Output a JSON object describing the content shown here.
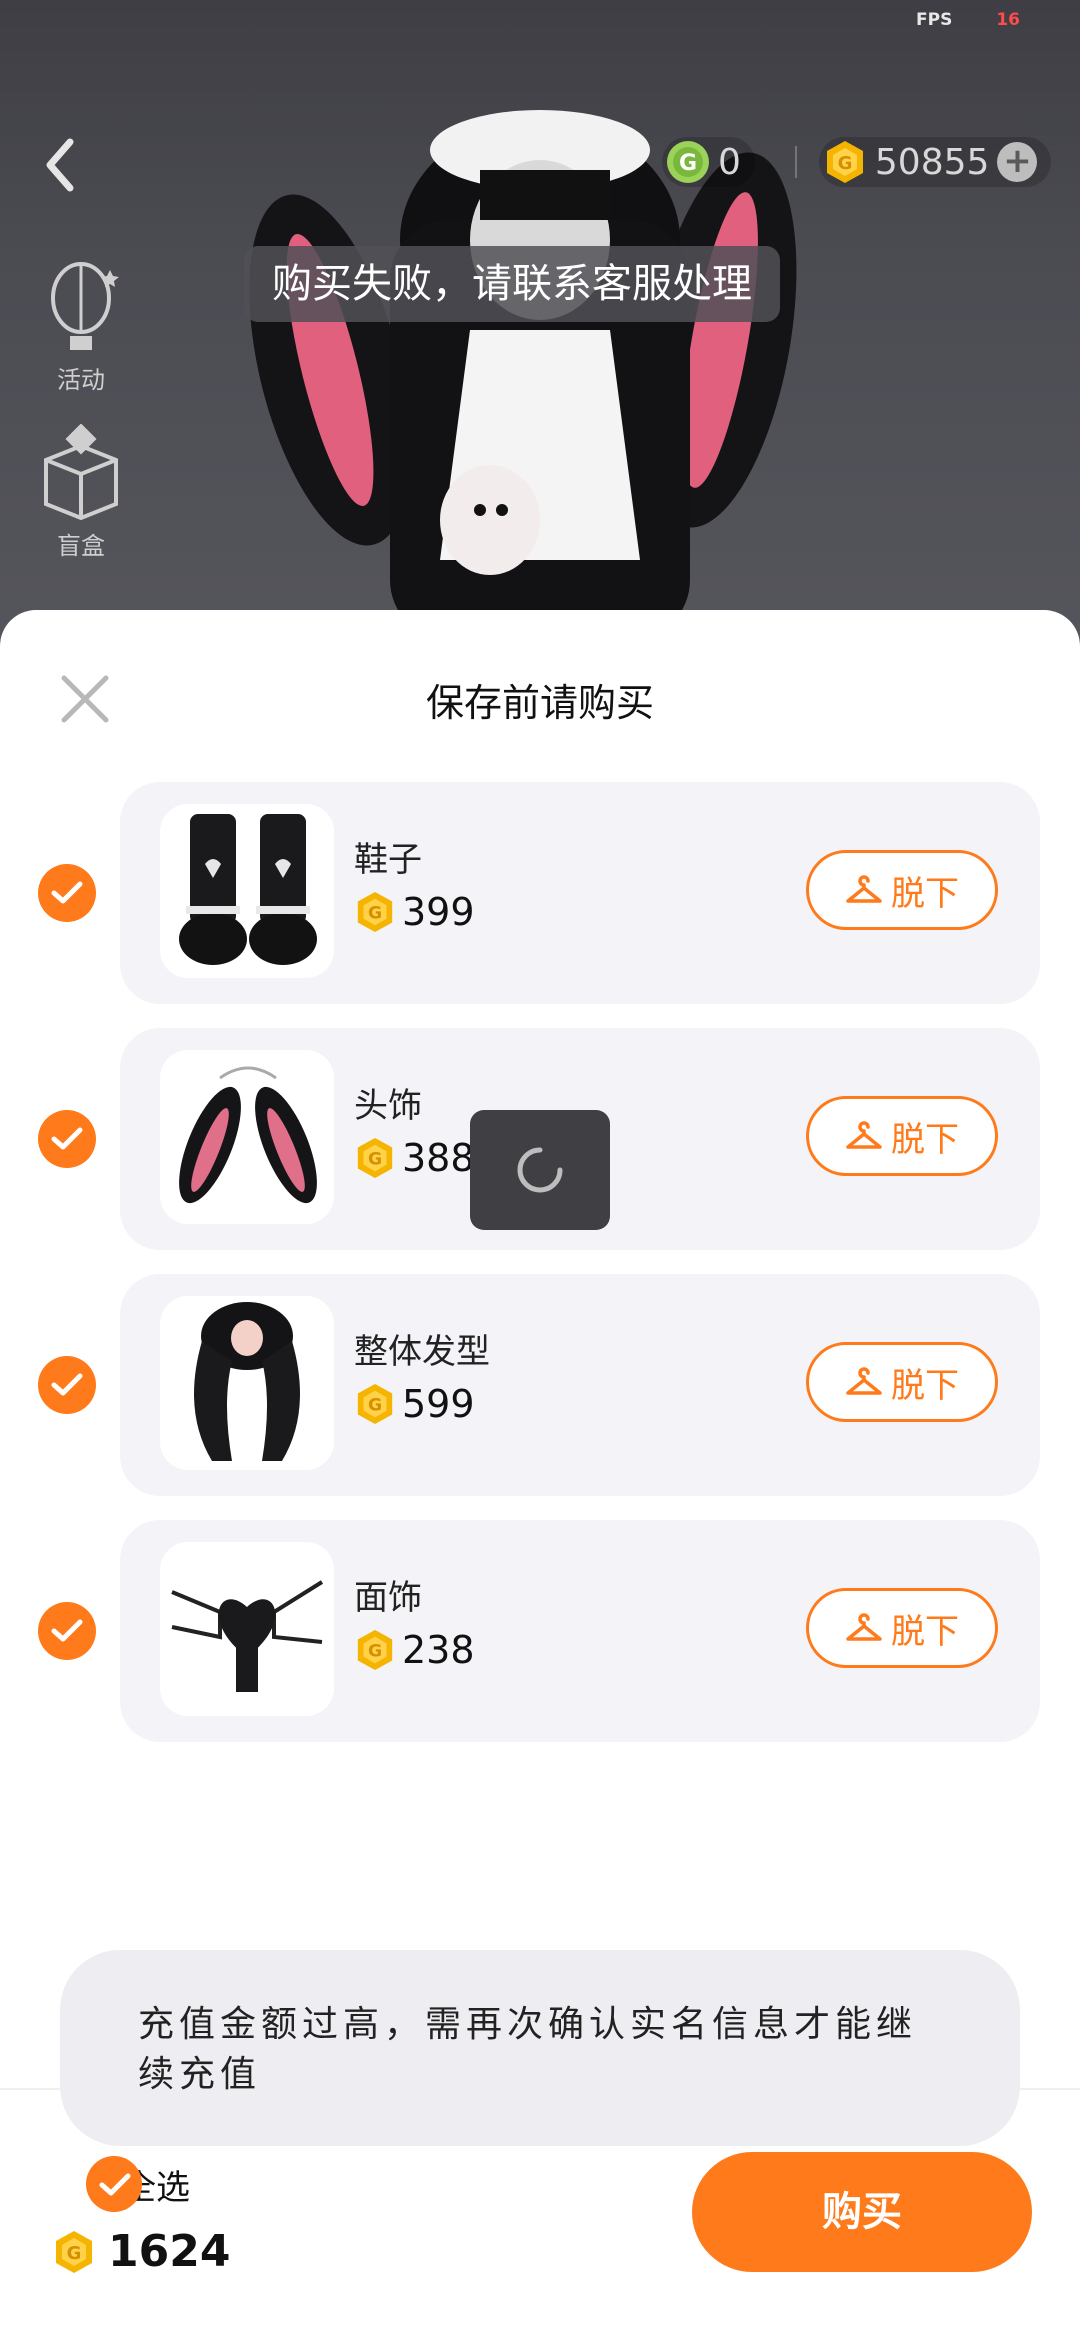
{
  "status": {
    "fps_label": "FPS",
    "fps_value": "16"
  },
  "header": {
    "gem_balance": "0",
    "coin_balance": "50855"
  },
  "side_menu": [
    {
      "label": "活动",
      "icon": "balloon-icon"
    },
    {
      "label": "盲盒",
      "icon": "mystery-box-icon"
    }
  ],
  "toast_top": "购买失败，请联系客服处理",
  "sheet": {
    "title": "保存前请购买",
    "items": [
      {
        "name": "鞋子",
        "price": "399",
        "action": "脱下"
      },
      {
        "name": "头饰",
        "price": "388",
        "action": "脱下"
      },
      {
        "name": "整体发型",
        "price": "599",
        "action": "脱下"
      },
      {
        "name": "面饰",
        "price": "238",
        "action": "脱下"
      }
    ]
  },
  "toast_bottom": "充值金额过高，需再次确认实名信息才能继续充值",
  "footer": {
    "select_all": "全选",
    "total": "1624",
    "buy": "购买"
  },
  "colors": {
    "accent": "#ff7a1a",
    "coin": "#f5b400"
  }
}
